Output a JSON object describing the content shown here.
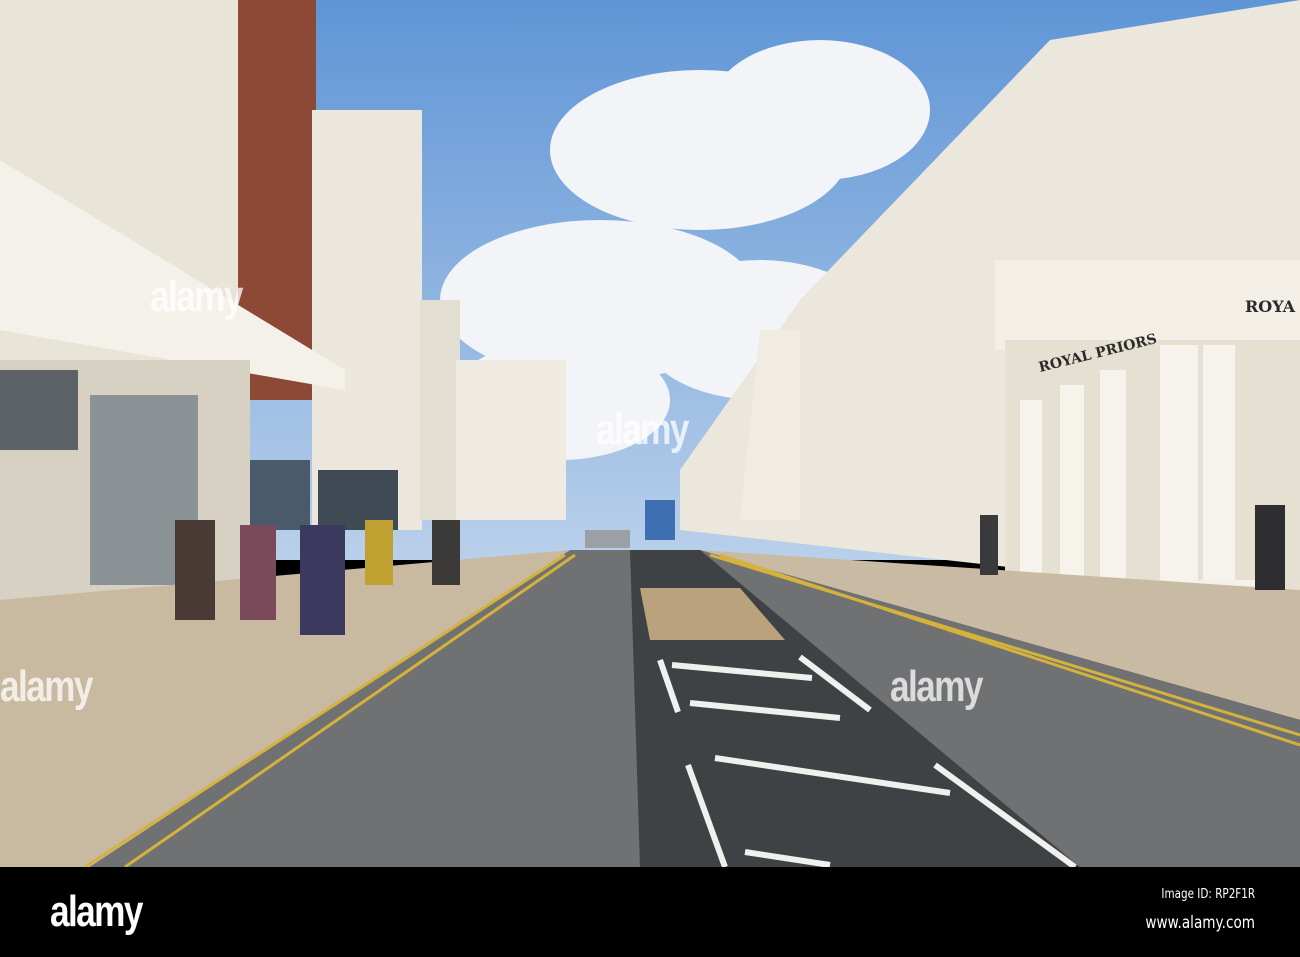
{
  "photo": {
    "signs": {
      "royal_priors": "ROYAL PRIORS",
      "royal_partial": "ROYA"
    }
  },
  "watermark": {
    "text": "alamy"
  },
  "footer": {
    "logo": "alamy",
    "image_id": "Image ID: RP2F1R",
    "website": "www.alamy.com"
  }
}
